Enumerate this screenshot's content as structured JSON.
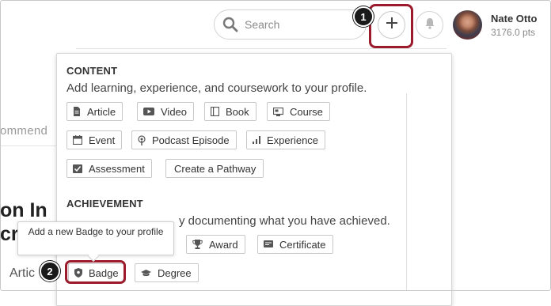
{
  "header": {
    "search_placeholder": "Search",
    "user_name": "Nate Otto",
    "user_points": "3176.0 pts"
  },
  "background": {
    "recommend_fragment": "ommend",
    "title_line1": "on In",
    "title_line2": "cr",
    "artic_fragment": "Artic"
  },
  "panel": {
    "content": {
      "title": "CONTENT",
      "subtitle": "Add learning, experience, and coursework to your profile.",
      "items": [
        {
          "label": "Article",
          "icon": "article-icon"
        },
        {
          "label": "Video",
          "icon": "video-icon"
        },
        {
          "label": "Book",
          "icon": "book-icon"
        },
        {
          "label": "Course",
          "icon": "course-icon"
        },
        {
          "label": "Event",
          "icon": "event-icon"
        },
        {
          "label": "Podcast Episode",
          "icon": "podcast-icon"
        },
        {
          "label": "Experience",
          "icon": "experience-icon"
        },
        {
          "label": "Assessment",
          "icon": "assessment-icon"
        },
        {
          "label": "Create a Pathway"
        }
      ]
    },
    "achievement": {
      "title": "ACHIEVEMENT",
      "subtitle_visible": "y documenting what you have achieved.",
      "items": [
        {
          "label": "Award",
          "icon": "award-icon"
        },
        {
          "label": "Certificate",
          "icon": "certificate-icon"
        },
        {
          "label": "Badge",
          "icon": "badge-icon"
        },
        {
          "label": "Degree",
          "icon": "degree-icon"
        }
      ]
    }
  },
  "tooltip": {
    "text": "Add a new Badge to your profile"
  },
  "callouts": {
    "step1": "1",
    "step2": "2"
  },
  "colors": {
    "highlight": "#9b1b2c",
    "callout": "#1a1a1a"
  }
}
